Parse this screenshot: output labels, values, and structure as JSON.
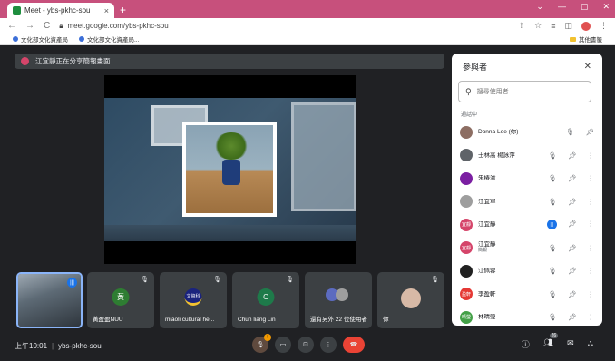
{
  "browser": {
    "tab_title": "Meet - ybs-pkhc-sou",
    "tab_close": "×",
    "new_tab": "+",
    "win_min": "⌄",
    "win_min2": "—",
    "win_max": "▢",
    "win_close": "✕",
    "url": "meet.google.com/ybs-pkhc-sou",
    "bookmarks": [
      "文化部文化資產局",
      "文化部文化資產局..."
    ],
    "bookmark_folder": "其他書籤"
  },
  "meeting": {
    "presenter_banner": "江宜靜正在分享簡報畫面",
    "time": "上午10:01",
    "separator": "|",
    "code": "ybs-pkhc-sou",
    "people_count": "26"
  },
  "tiles": [
    {
      "name": "",
      "type": "self"
    },
    {
      "name": "黃盈盈NUU",
      "avatar_text": "黃",
      "avatar_color": "#2e7d32",
      "muted": true
    },
    {
      "name": "miaoli cultural he...",
      "avatar_text": "文資科",
      "avatar_color": "#1a237e",
      "muted": true
    },
    {
      "name": "Chun liang Lin",
      "avatar_text": "C",
      "avatar_color": "#1e7a4a",
      "muted": true
    },
    {
      "name": "還有另外 22 位使用者",
      "avatar_text": "",
      "muted": false
    },
    {
      "name": "你",
      "avatar_text": "",
      "muted": true
    }
  ],
  "panel": {
    "title": "參與者",
    "search_placeholder": "搜尋使用者",
    "section": "通話中",
    "people": [
      {
        "name": "Donna Lee (你)",
        "sub": "",
        "color": "#8d6e63",
        "initial": "D"
      },
      {
        "name": "士林高 楊詠萍",
        "sub": "",
        "color": "#5f6368",
        "initial": "士"
      },
      {
        "name": "朱椿滋",
        "sub": "",
        "color": "#7b1fa2",
        "initial": "朱"
      },
      {
        "name": "江宜軍",
        "sub": "",
        "color": "#9e9e9e",
        "initial": "江"
      },
      {
        "name": "江宜靜",
        "sub": "",
        "color": "#d5456a",
        "initial": "宜靜"
      },
      {
        "name": "江宜靜",
        "sub": "簡報",
        "color": "#d5456a",
        "initial": "宜靜"
      },
      {
        "name": "江佩蓉",
        "sub": "",
        "color": "#212121",
        "initial": "江"
      },
      {
        "name": "李盈軒",
        "sub": "",
        "color": "#e53935",
        "initial": "盈軒"
      },
      {
        "name": "林晴瑩",
        "sub": "",
        "color": "#43a047",
        "initial": "晴瑩"
      }
    ]
  }
}
